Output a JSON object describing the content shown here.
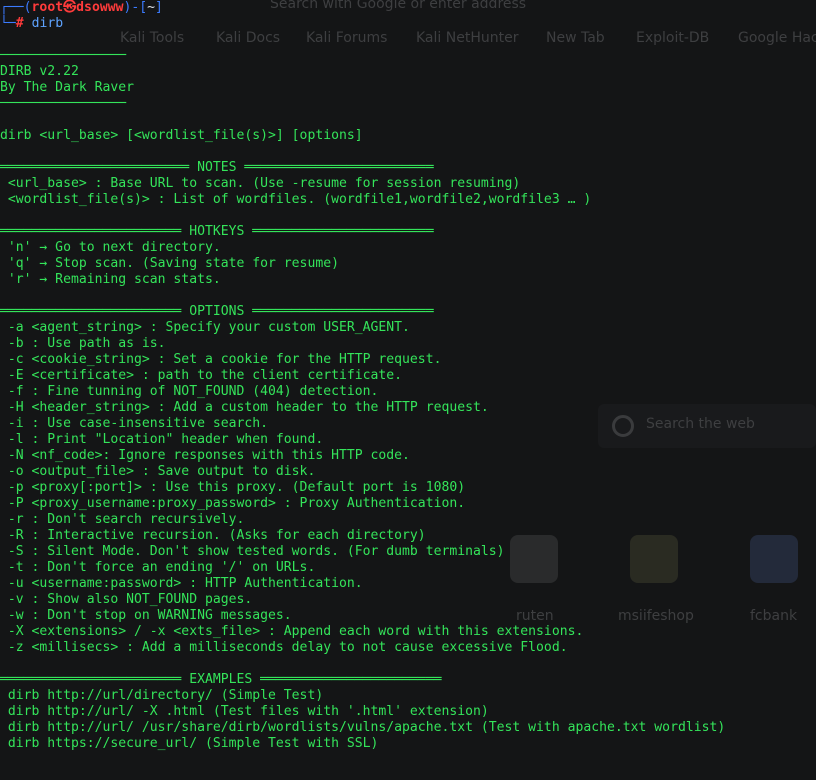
{
  "background": {
    "search_text": "Search with Google or enter address",
    "bookmarks": [
      "Kali Tools",
      "Kali Docs",
      "Kali Forums",
      "Kali NetHunter",
      "New Tab",
      "Exploit-DB",
      "Google Hac"
    ],
    "search_web": "Search the web",
    "tiles": [
      "ruten",
      "msiifeshop",
      "fcbank"
    ]
  },
  "prompt": {
    "corner_top": "┌──(",
    "user_host": "root㉿dsowww",
    "dash": ")-[",
    "cwd": "~",
    "close": "]",
    "corner_bottom": "└─",
    "hash": "#",
    "command": "dirb"
  },
  "output": {
    "rule": "────────────────",
    "version": "DIRB v2.22",
    "author": "By The Dark Raver",
    "usage": "dirb <url_base> [<wordlist_file(s)>] [options]",
    "notes_header": "════════════════════════ NOTES ════════════════════════",
    "notes": [
      " <url_base> : Base URL to scan. (Use -resume for session resuming)",
      " <wordlist_file(s)> : List of wordfiles. (wordfile1,wordfile2,wordfile3 … )"
    ],
    "hotkeys_header": "═══════════════════════ HOTKEYS ═══════════════════════",
    "hotkeys": [
      " 'n' → Go to next directory.",
      " 'q' → Stop scan. (Saving state for resume)",
      " 'r' → Remaining scan stats."
    ],
    "options_header": "═══════════════════════ OPTIONS ═══════════════════════",
    "options": [
      " -a <agent_string> : Specify your custom USER_AGENT.",
      " -b : Use path as is.",
      " -c <cookie_string> : Set a cookie for the HTTP request.",
      " -E <certificate> : path to the client certificate.",
      " -f : Fine tunning of NOT_FOUND (404) detection.",
      " -H <header_string> : Add a custom header to the HTTP request.",
      " -i : Use case-insensitive search.",
      " -l : Print \"Location\" header when found.",
      " -N <nf_code>: Ignore responses with this HTTP code.",
      " -o <output_file> : Save output to disk.",
      " -p <proxy[:port]> : Use this proxy. (Default port is 1080)",
      " -P <proxy_username:proxy_password> : Proxy Authentication.",
      " -r : Don't search recursively.",
      " -R : Interactive recursion. (Asks for each directory)",
      " -S : Silent Mode. Don't show tested words. (For dumb terminals)",
      " -t : Don't force an ending '/' on URLs.",
      " -u <username:password> : HTTP Authentication.",
      " -v : Show also NOT_FOUND pages.",
      " -w : Don't stop on WARNING messages.",
      " -X <extensions> / -x <exts_file> : Append each word with this extensions.",
      " -z <millisecs> : Add a milliseconds delay to not cause excessive Flood."
    ],
    "examples_header": "═══════════════════════ EXAMPLES ═══════════════════════",
    "examples": [
      " dirb http://url/directory/ (Simple Test)",
      " dirb http://url/ -X .html (Test files with '.html' extension)",
      " dirb http://url/ /usr/share/dirb/wordlists/vulns/apache.txt (Test with apache.txt wordlist)",
      " dirb https://secure_url/ (Simple Test with SSL)"
    ]
  }
}
